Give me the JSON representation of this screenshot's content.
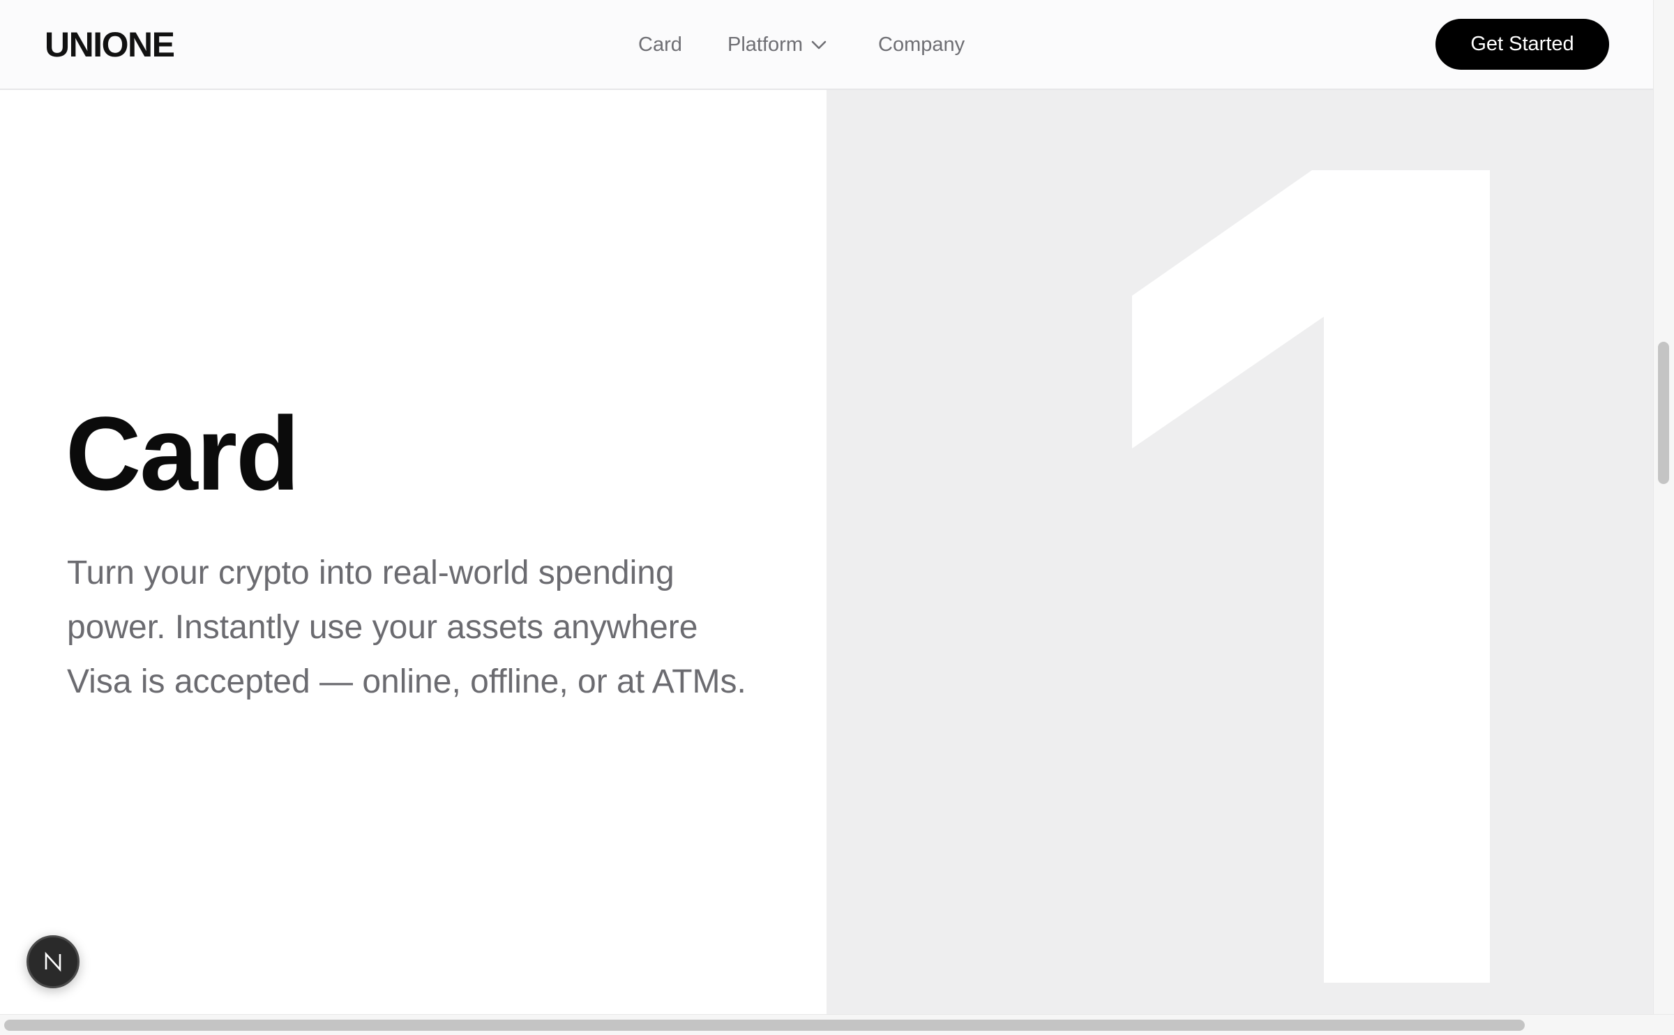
{
  "header": {
    "logo": "UNIONE",
    "nav": [
      {
        "label": "Card"
      },
      {
        "label": "Platform",
        "has_dropdown": true
      },
      {
        "label": "Company"
      }
    ],
    "cta_label": "Get Started"
  },
  "hero": {
    "title": "Card",
    "description": "Turn your crypto into real-world spending power. Instantly use your assets anywhere Visa is accepted — online, offline, or at ATMs.",
    "graphic_icon": "numeral-one-graphic"
  },
  "floating_badge": {
    "icon": "n-logo-icon"
  },
  "colors": {
    "header_bg": "#fbfbfc",
    "hero_right_bg": "#eeeeef",
    "cta_bg": "#000000",
    "text_muted": "#6b6b70"
  }
}
